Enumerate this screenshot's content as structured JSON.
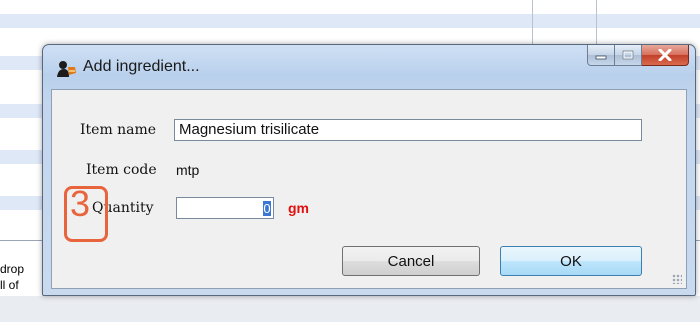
{
  "background": {
    "side_text": [
      "drop",
      "ll of"
    ]
  },
  "dialog": {
    "title": "Add ingredient...",
    "icons": {
      "app": "pharmacy-app-icon",
      "minimize": "minimize-icon",
      "maximize": "maximize-icon",
      "close": "close-icon"
    },
    "item_name_label": "Item name",
    "item_name_value": "Magnesium trisilicate",
    "item_code_label": "Item code",
    "item_code_value": "mtp",
    "quantity_label": "Quantity",
    "quantity_value": "0",
    "quantity_unit": "gm",
    "cancel_label": "Cancel",
    "ok_label": "OK"
  },
  "annotation": {
    "number": "3",
    "color": "#e8643c"
  },
  "colors": {
    "unit": "#e01010",
    "selection": "#3a78d4"
  }
}
